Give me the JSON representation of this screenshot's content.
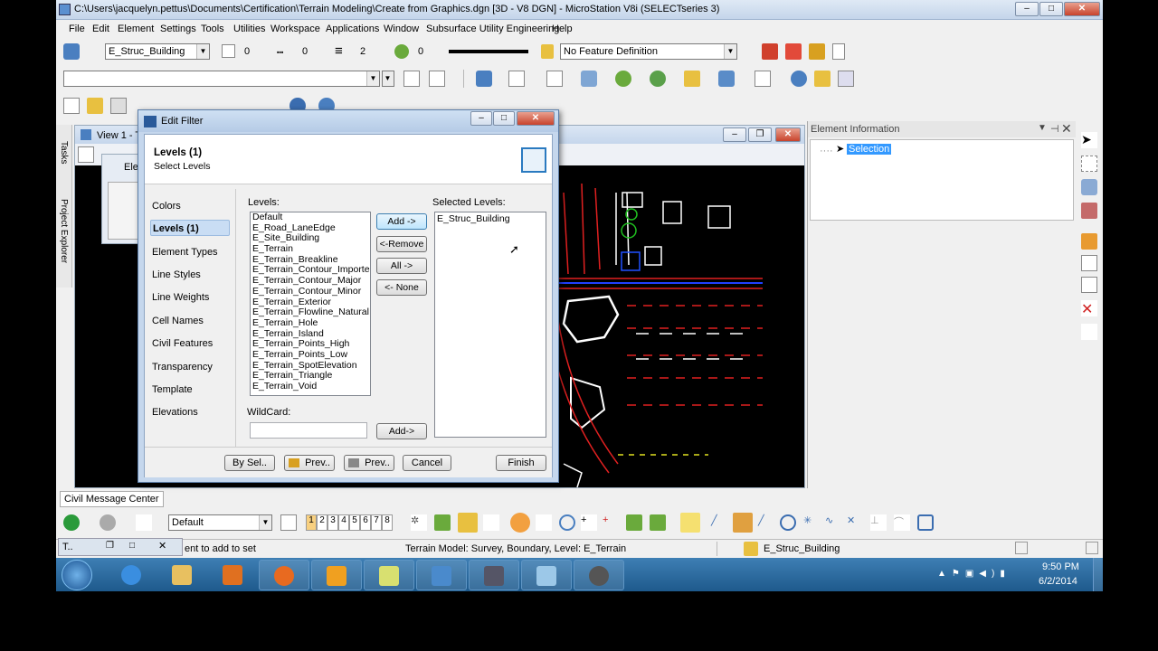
{
  "window": {
    "title": "C:\\Users\\jacquelyn.pettus\\Documents\\Certification\\Terrain Modeling\\Create from Graphics.dgn [3D - V8 DGN] - MicroStation V8i (SELECTseries 3)"
  },
  "menu": [
    "File",
    "Edit",
    "Element",
    "Settings",
    "Tools",
    "Utilities",
    "Workspace",
    "Applications",
    "Window",
    "Subsurface Utility Engineering",
    "Help"
  ],
  "toolbar": {
    "active_level": "E_Struc_Building",
    "color_value": "0",
    "style_value": "0",
    "weight_value": "2",
    "transparency_value": "0",
    "feature_definition": "No Feature Definition"
  },
  "view": {
    "title": "View 1 - T"
  },
  "element_info": {
    "title": "Element Information",
    "selection_label": "Selection"
  },
  "side_tabs": {
    "tasks": "Tasks",
    "project_explorer": "Project Explorer"
  },
  "behind_dialog": {
    "title": "Ele"
  },
  "dialog": {
    "title": "Edit Filter",
    "heading": "Levels (1)",
    "subheading": "Select Levels",
    "nav": [
      "Colors",
      "Levels (1)",
      "Element Types",
      "Line Styles",
      "Line Weights",
      "Cell Names",
      "Civil Features",
      "Transparency",
      "Template",
      "Elevations"
    ],
    "levels_label": "Levels:",
    "levels": [
      "Default",
      "E_Road_LaneEdge",
      "E_Site_Building",
      "E_Terrain",
      "E_Terrain_Breakline",
      "E_Terrain_Contour_Imported",
      "E_Terrain_Contour_Major",
      "E_Terrain_Contour_Minor",
      "E_Terrain_Exterior",
      "E_Terrain_Flowline_Natural",
      "E_Terrain_Hole",
      "E_Terrain_Island",
      "E_Terrain_Points_High",
      "E_Terrain_Points_Low",
      "E_Terrain_SpotElevation",
      "E_Terrain_Triangle",
      "E_Terrain_Void"
    ],
    "selected_label": "Selected Levels:",
    "selected": [
      "E_Struc_Building"
    ],
    "buttons": {
      "add": "Add ->",
      "remove": "<-Remove",
      "all": "All ->",
      "none": "<- None",
      "wild_add": "Add->"
    },
    "wildcard_label": "WildCard:",
    "footer": {
      "by_sel": "By Sel..",
      "prev1": "Prev..",
      "prev2": "Prev..",
      "cancel": "Cancel",
      "finish": "Finish"
    }
  },
  "civil_tab": "Civil Message Center",
  "bottom_toolbar": {
    "template": "Default",
    "view_numbers": [
      "1",
      "2",
      "3",
      "4",
      "5",
      "6",
      "7",
      "8"
    ]
  },
  "status": {
    "left_fragment": "ent to add to set",
    "tool_tab": "T..",
    "message": "Terrain Model: Survey, Boundary, Level: E_Terrain",
    "level": "E_Struc_Building"
  },
  "taskbar": {
    "time": "9:50 PM",
    "date": "6/2/2014"
  }
}
